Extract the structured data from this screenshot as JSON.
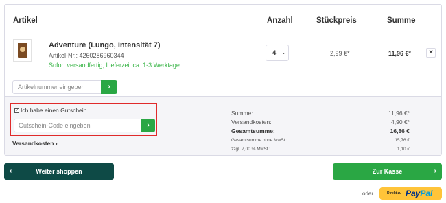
{
  "table_header": {
    "artikel": "Artikel",
    "anzahl": "Anzahl",
    "stueckpreis": "Stückpreis",
    "summe": "Summe"
  },
  "product": {
    "name": "Adventure (Lungo, Intensität 7)",
    "article_no": "Artikel-Nr.: 4260286960344",
    "shipping": "Sofort versandfertig, Lieferzeit ca. 1-3 Werktage",
    "quantity": "4",
    "unit_price": "2,99 €*",
    "line_total": "11,96 €*",
    "remove_icon": "close-icon"
  },
  "article_input": {
    "placeholder": "Artikelnummer eingeben",
    "button_icon": "chevron-right-icon"
  },
  "voucher": {
    "checkbox_label": "Ich habe einen Gutschein",
    "checked": true,
    "placeholder": "Gutschein-Code eingeben"
  },
  "versand_link": "Versandkosten",
  "summary": {
    "rows": [
      {
        "label": "Summe:",
        "value": "11,96 €*"
      },
      {
        "label": "Versandkosten:",
        "value": "4,90 €*"
      },
      {
        "label": "Gesamtsumme:",
        "value": "16,86 €"
      },
      {
        "label": "Gesamtsumme ohne MwSt.:",
        "value": "15,76 €"
      },
      {
        "label": "zzgl. 7,00 % MwSt.:",
        "value": "1,10 €"
      }
    ]
  },
  "buttons": {
    "back": "Weiter shoppen",
    "checkout": "Zur Kasse",
    "back_arrow": "‹",
    "forward_arrow": "›"
  },
  "paypal": {
    "oder": "oder",
    "small": "Direkt zu",
    "pay": "Pay",
    "pal": "Pal"
  },
  "colors": {
    "green": "#2aa744",
    "dark_teal": "#0e4a46",
    "highlight_red": "#e02b2b",
    "paypal_yellow": "#ffc439"
  }
}
